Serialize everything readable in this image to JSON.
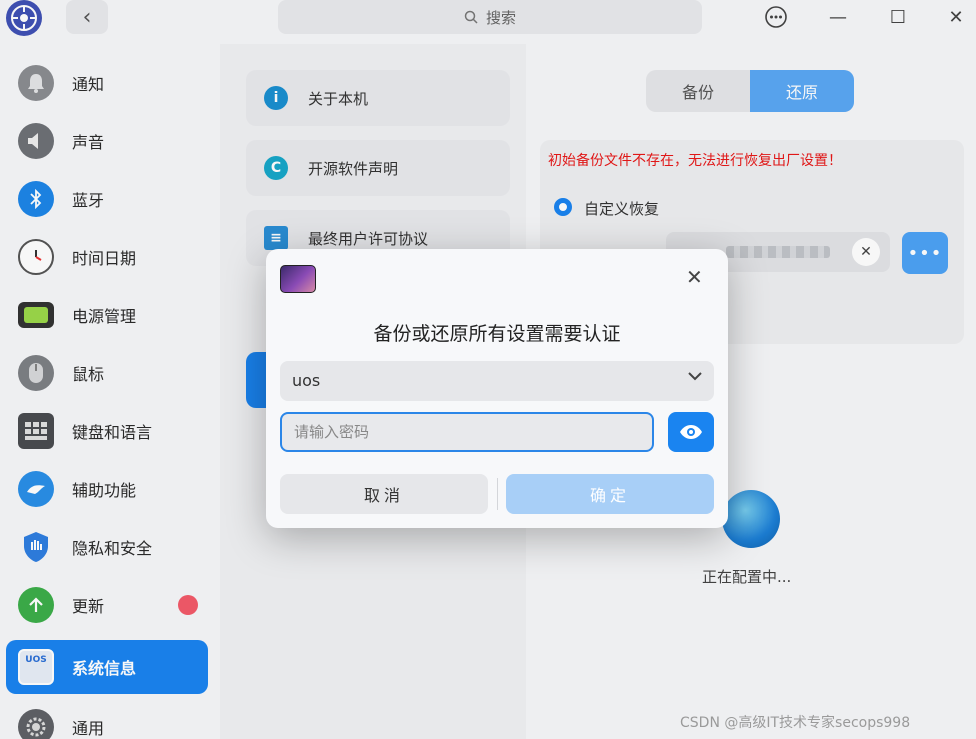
{
  "titlebar": {
    "search_placeholder": "搜索",
    "back_glyph": "‹",
    "more_glyph": "···",
    "minimize_glyph": "—",
    "maximize_glyph": "☐",
    "close_glyph": "✕"
  },
  "nav": {
    "items": [
      {
        "label": "通知",
        "icon": "bell-icon"
      },
      {
        "label": "声音",
        "icon": "speaker-icon"
      },
      {
        "label": "蓝牙",
        "icon": "bluetooth-icon"
      },
      {
        "label": "时间日期",
        "icon": "clock-icon"
      },
      {
        "label": "电源管理",
        "icon": "battery-icon"
      },
      {
        "label": "鼠标",
        "icon": "mouse-icon"
      },
      {
        "label": "键盘和语言",
        "icon": "keyboard-icon"
      },
      {
        "label": "辅助功能",
        "icon": "accessibility-icon"
      },
      {
        "label": "隐私和安全",
        "icon": "shield-icon"
      },
      {
        "label": "更新",
        "icon": "update-icon"
      },
      {
        "label": "系统信息",
        "icon": "system-info-icon",
        "icon_text": "UOS"
      },
      {
        "label": "通用",
        "icon": "gear-icon"
      }
    ],
    "active_index": 10
  },
  "middle": {
    "items": [
      {
        "label": "关于本机",
        "icon": "info-icon",
        "glyph": "i"
      },
      {
        "label": "开源软件声明",
        "icon": "copyright-icon",
        "glyph": "C"
      },
      {
        "label": "最终用户许可协议",
        "icon": "document-icon",
        "glyph": "≡"
      }
    ]
  },
  "backup": {
    "tabs": [
      "备份",
      "还原"
    ],
    "active_tab": 1,
    "warning": "初始备份文件不存在，无法进行恢复出厂设置！",
    "radio_label": "自定义恢复",
    "clear_glyph": "✕",
    "more_glyph": "•••",
    "loading_text": "正在配置中..."
  },
  "dialog": {
    "title": "备份或还原所有设置需要认证",
    "close_glyph": "✕",
    "user_value": "uos",
    "chevron_glyph": "⌄",
    "password_placeholder": "请输入密码",
    "cancel_label": "取消",
    "ok_label": "确定"
  },
  "watermark": "CSDN @高级IT技术专家secops998",
  "colors": {
    "accent": "#1a84f0",
    "warning": "#e81818",
    "badge": "#f35a6a"
  }
}
